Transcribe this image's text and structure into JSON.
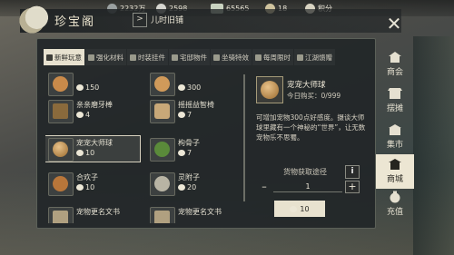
{
  "currencies": [
    {
      "icon": "silver-ingot-icon",
      "value": "2232万",
      "color": "#9aa0a0"
    },
    {
      "icon": "silver-coin-icon",
      "value": "2598",
      "color": "#d6d6d0"
    },
    {
      "icon": "jade-ticket-icon",
      "value": "65565",
      "color": "#c9d3c0"
    },
    {
      "icon": "gold-ingot-icon",
      "value": "18",
      "color": "#cfc39e"
    },
    {
      "icon": "points-icon",
      "value": "积分",
      "color": "#d9d4c2"
    }
  ],
  "window": {
    "title": "珍宝阁",
    "breadcrumb": "儿时旧铺",
    "close_glyph": "✕"
  },
  "tabs": [
    {
      "label": "新鲜玩意",
      "active": true
    },
    {
      "label": "强化材料",
      "active": false
    },
    {
      "label": "时装挂件",
      "active": false
    },
    {
      "label": "宅邸物件",
      "active": false
    },
    {
      "label": "坐骑特效",
      "active": false
    },
    {
      "label": "每周限时",
      "active": false
    },
    {
      "label": "江湖馈赠",
      "active": false
    }
  ],
  "items": [
    {
      "name": "",
      "price": "150",
      "icon_color": "#c98a4a"
    },
    {
      "name": "",
      "price": "300",
      "icon_color": "#d09a5a"
    },
    {
      "name": "亲亲磨牙棒",
      "price": "4",
      "icon_color": "#8a6a3c"
    },
    {
      "name": "摇摇益智椅",
      "price": "7",
      "icon_color": "#c8a878"
    },
    {
      "name": "宠宠大师球",
      "price": "10",
      "icon_color": "#c0904a"
    },
    {
      "name": "枸骨子",
      "price": "7",
      "icon_color": "#5a8a3a"
    },
    {
      "name": "合欢子",
      "price": "10",
      "icon_color": "#b8763a"
    },
    {
      "name": "灵附子",
      "price": "20",
      "icon_color": "#b8b4a4"
    },
    {
      "name": "宠物更名文书",
      "price": "",
      "icon_color": "#b0a080"
    },
    {
      "name": "宠物更名文书",
      "price": "",
      "icon_color": "#b0a080"
    }
  ],
  "detail": {
    "name": "宠宠大师球",
    "purchased_label": "今日购买：0/999",
    "description": "可增加宠物300点好感度。摄谈大师球里藏有一个神秘的“世界”，让无数宠物乐不思蜀。",
    "source_label": "货物获取途径",
    "info_glyph": "i",
    "minus_glyph": "–",
    "plus_glyph": "+",
    "quantity": "1",
    "total_price": "10"
  },
  "sidenav": [
    {
      "label": "商会",
      "active": false
    },
    {
      "label": "摆摊",
      "active": false
    },
    {
      "label": "集市",
      "active": false
    },
    {
      "label": "商城",
      "active": true
    },
    {
      "label": "充值",
      "active": false
    }
  ]
}
